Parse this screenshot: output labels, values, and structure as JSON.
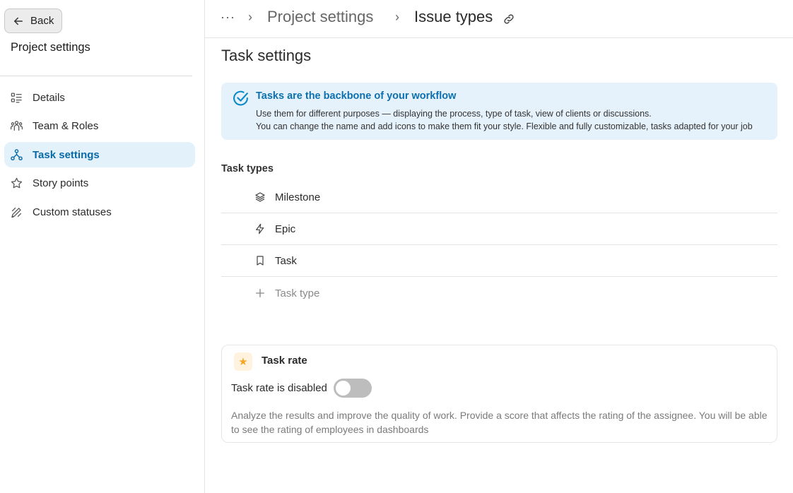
{
  "sidebar": {
    "back_label": "Back",
    "title": "Project settings",
    "items": [
      {
        "label": "Details",
        "icon": "list-icon"
      },
      {
        "label": "Team & Roles",
        "icon": "team-icon"
      },
      {
        "label": "Task settings",
        "icon": "hierarchy-icon",
        "active": true
      },
      {
        "label": "Story points",
        "icon": "star-outline-icon"
      },
      {
        "label": "Custom statuses",
        "icon": "pencil-icon"
      }
    ]
  },
  "header": {
    "more_label": "···",
    "breadcrumb": [
      "Project settings",
      "Issue types"
    ],
    "separator": "›"
  },
  "main": {
    "title": "Task settings",
    "banner": {
      "title": "Tasks are the backbone of your workflow",
      "line1": "Use them for different purposes — displaying the process, type of task, view of clients or discussions.",
      "line2": "You can change the name and add icons to make them fit your style. Flexible and fully customizable, tasks adapted for your job"
    },
    "types_title": "Task types",
    "types": [
      {
        "label": "Milestone",
        "icon": "layers-icon"
      },
      {
        "label": "Epic",
        "icon": "lightning-icon"
      },
      {
        "label": "Task",
        "icon": "bookmark-icon"
      }
    ],
    "add_type_label": "Task type",
    "rate": {
      "title": "Task rate",
      "status": "Task rate is disabled",
      "enabled": false,
      "description": "Analyze the results and improve the quality of work. Provide a score that affects the rating of the assignee. You will be able to see the rating of employees in dashboards"
    }
  },
  "colors": {
    "accent": "#0a6aa8",
    "active_bg": "#e3f1fb",
    "banner_bg": "#e6f2fb",
    "star": "#f5a623"
  }
}
